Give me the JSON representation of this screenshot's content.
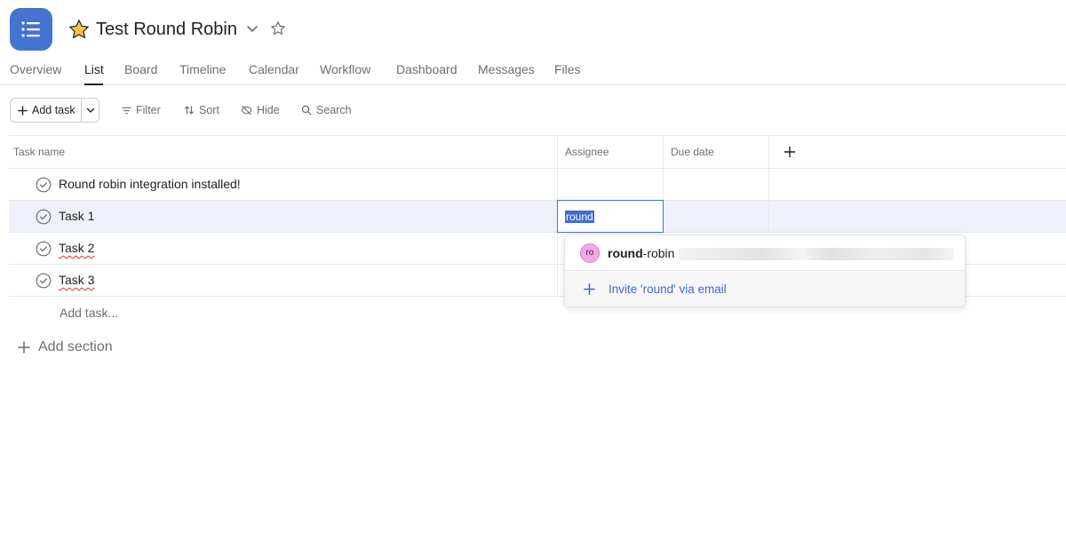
{
  "header": {
    "project_title": "Test Round Robin",
    "app_icon": "list-icon",
    "brand_color": "#4573d2"
  },
  "tabs": [
    {
      "label": "Overview",
      "active": false
    },
    {
      "label": "List",
      "active": true
    },
    {
      "label": "Board",
      "active": false
    },
    {
      "label": "Timeline",
      "active": false
    },
    {
      "label": "Calendar",
      "active": false
    },
    {
      "label": "Workflow",
      "active": false
    },
    {
      "label": "Dashboard",
      "active": false
    },
    {
      "label": "Messages",
      "active": false
    },
    {
      "label": "Files",
      "active": false
    }
  ],
  "toolbar": {
    "add_task_label": "Add task",
    "filter_label": "Filter",
    "sort_label": "Sort",
    "hide_label": "Hide",
    "search_label": "Search"
  },
  "table": {
    "columns": [
      "Task name",
      "Assignee",
      "Due date"
    ],
    "rows": [
      {
        "name": "Round robin integration installed!",
        "selected": false
      },
      {
        "name": "Task 1",
        "selected": true
      },
      {
        "name": "Task 2",
        "selected": false
      },
      {
        "name": "Task 3",
        "selected": false
      }
    ],
    "add_task_placeholder": "Add task...",
    "add_section_label": "Add section"
  },
  "assignee_editor": {
    "input_value": "round"
  },
  "assignee_dropdown": {
    "suggestion_initials": "ro",
    "suggestion_match": "round",
    "suggestion_rest": "-robin",
    "invite_label": "Invite 'round' via email",
    "accent_color": "#3b6bc9"
  }
}
